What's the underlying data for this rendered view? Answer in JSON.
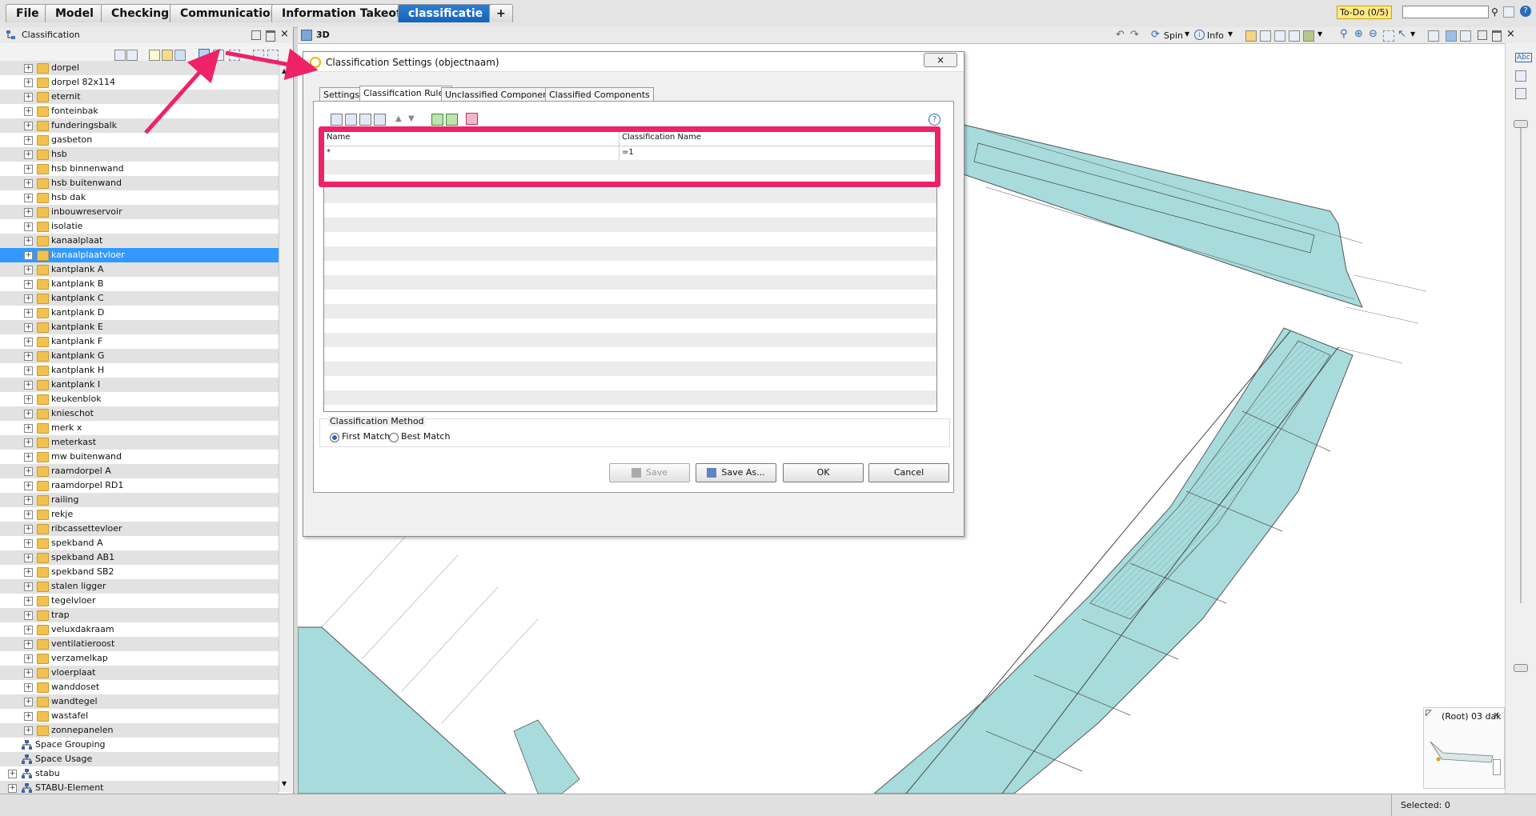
{
  "menubar": {
    "tabs": [
      "File",
      "Model",
      "Checking",
      "Communication",
      "Information Takeoff",
      "classificatie"
    ],
    "add_tab": "+",
    "todo": "To-Do (0/5)"
  },
  "left_panel": {
    "title": "Classification",
    "tree_items": [
      "dorpel",
      "dorpel 82x114",
      "eternit",
      "fonteinbak",
      "funderingsbalk",
      "gasbeton",
      "hsb",
      "hsb binnenwand",
      "hsb buitenwand",
      "hsb dak",
      "inbouwreservoir",
      "isolatie",
      "kanaalplaat",
      "kanaalplaatvloer",
      "kantplank A",
      "kantplank B",
      "kantplank C",
      "kantplank D",
      "kantplank E",
      "kantplank F",
      "kantplank G",
      "kantplank H",
      "kantplank I",
      "keukenblok",
      "knieschot",
      "merk x",
      "meterkast",
      "mw buitenwand",
      "raamdorpel A",
      "raamdorpel RD1",
      "railing",
      "rekje",
      "ribcassettevloer",
      "spekband A",
      "spekband AB1",
      "spekband SB2",
      "stalen ligger",
      "tegelvloer",
      "trap",
      "veluxdakraam",
      "ventilatieroost",
      "verzamelkap",
      "vloerplaat",
      "wanddoset",
      "wandtegel",
      "wastafel",
      "zonnepanelen"
    ],
    "selected_item": "kanaalplaatvloer",
    "root_items": [
      "Space Grouping",
      "Space Usage",
      "stabu",
      "STABU-Element"
    ]
  },
  "view": {
    "title": "3D",
    "toolbar": {
      "spin": "Spin",
      "info": "Info"
    },
    "right_tools": [
      "Abc"
    ],
    "navigator_label": "(Root) 03 dak"
  },
  "dialog": {
    "title": "Classification Settings (objectnaam)",
    "tabs": [
      "Settings",
      "Classification Rules",
      "Unclassified Components",
      "Classified Components"
    ],
    "active_tab": "Classification Rules",
    "help": "?",
    "grid": {
      "columns": [
        "Name",
        "Classification Name"
      ],
      "rows": [
        {
          "name": "*",
          "classification": "=1"
        }
      ]
    },
    "method": {
      "legend": "Classification Method",
      "options": [
        "First Match",
        "Best Match"
      ],
      "selected": "First Match"
    },
    "buttons": {
      "save": "Save",
      "save_as": "Save As...",
      "ok": "OK",
      "cancel": "Cancel"
    }
  },
  "status": {
    "selected": "Selected: 0"
  },
  "colors": {
    "highlight": "#ee2266",
    "selection": "#3399ff",
    "model_fill": "#a8dcdc"
  }
}
